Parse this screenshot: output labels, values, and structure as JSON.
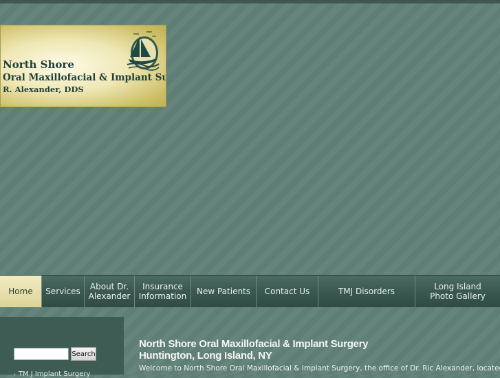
{
  "logo": {
    "line1": "North Shore",
    "line2": "Oral Maxillofacial & Implant Surgery",
    "line3": "R. Alexander, DDS"
  },
  "nav": {
    "items": [
      {
        "label": "Home",
        "active": true
      },
      {
        "label": "Services"
      },
      {
        "label": "About Dr.\nAlexander"
      },
      {
        "label": "Insurance\nInformation"
      },
      {
        "label": "New Patients"
      },
      {
        "label": "Contact Us"
      },
      {
        "label": "TMJ Disorders"
      },
      {
        "label": "Long Island\nPhoto Gallery"
      }
    ]
  },
  "sidebar": {
    "search_value": "",
    "search_button": "Search",
    "link1": "TM J Implant Surgery"
  },
  "main": {
    "heading_line1": "North Shore Oral Maxillofacial & Implant Surgery",
    "heading_line2": "Huntington, Long Island, NY",
    "welcome": "Welcome to North Shore Oral Maxillofacial & Implant Surgery, the office of Dr. Ric Alexander, located in the scenic village"
  },
  "colors": {
    "background": "#5e7d75",
    "nav_active": "#ddd396",
    "sidebar": "#3e5c54",
    "logo_gold": "#cbbd63"
  },
  "icons": {
    "logo_mark": "sailboat-icon",
    "link_bullet": "arrow-right-icon"
  }
}
